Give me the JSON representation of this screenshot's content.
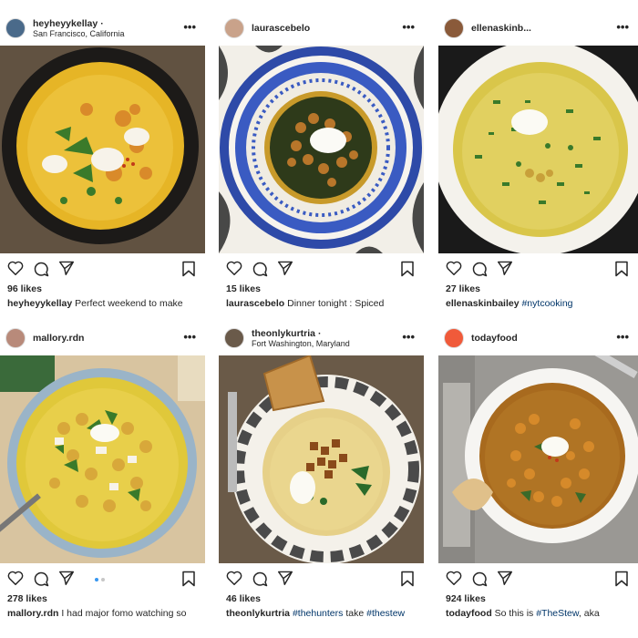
{
  "posts": [
    {
      "username": "heyheyykellay",
      "location": "San Francisco, California",
      "likes": "96 likes",
      "caption_user": "heyheyykellay",
      "caption_text": "Perfect weekend to make",
      "caption_tag": "",
      "caption_rest": "",
      "avatar_color": "#4a6a8a"
    },
    {
      "username": "laurascebelo",
      "location": "",
      "likes": "15 likes",
      "caption_user": "laurascebelo",
      "caption_text": "Dinner tonight : Spiced",
      "caption_tag": "",
      "caption_rest": "",
      "avatar_color": "#c9a28a"
    },
    {
      "username": "ellenaskinb...",
      "location": "",
      "likes": "27 likes",
      "caption_user": "ellenaskinbailey",
      "caption_text": "",
      "caption_tag": "#nytcooking",
      "caption_rest": "",
      "avatar_color": "#8a5a3a"
    },
    {
      "username": "mallory.rdn",
      "location": "",
      "likes": "278 likes",
      "caption_user": "mallory.rdn",
      "caption_text": "I had major fomo watching so",
      "caption_tag": "",
      "caption_rest": "",
      "avatar_color": "#b88a7a"
    },
    {
      "username": "theonlykurtria",
      "location": "Fort Washington, Maryland",
      "likes": "46 likes",
      "caption_user": "theonlykurtria",
      "caption_text": "",
      "caption_tag": "#thehunters",
      "caption_rest": "take",
      "caption_tag2": "#thestew",
      "avatar_color": "#6a5a4a"
    },
    {
      "username": "todayfood",
      "location": "",
      "likes": "924 likes",
      "caption_user": "todayfood",
      "caption_text": "So this is",
      "caption_tag": "#TheStew",
      "caption_rest": ", aka",
      "avatar_color": "#f05a3a"
    }
  ],
  "icons": {
    "like": "heart-icon",
    "comment": "comment-icon",
    "share": "share-icon",
    "save": "bookmark-icon",
    "more": "more-icon",
    "more_glyph": "•••"
  },
  "colors": {
    "text": "#262626",
    "hashtag": "#003569",
    "pager_active": "#3897f0",
    "soup_yellow": "#e8c130"
  }
}
